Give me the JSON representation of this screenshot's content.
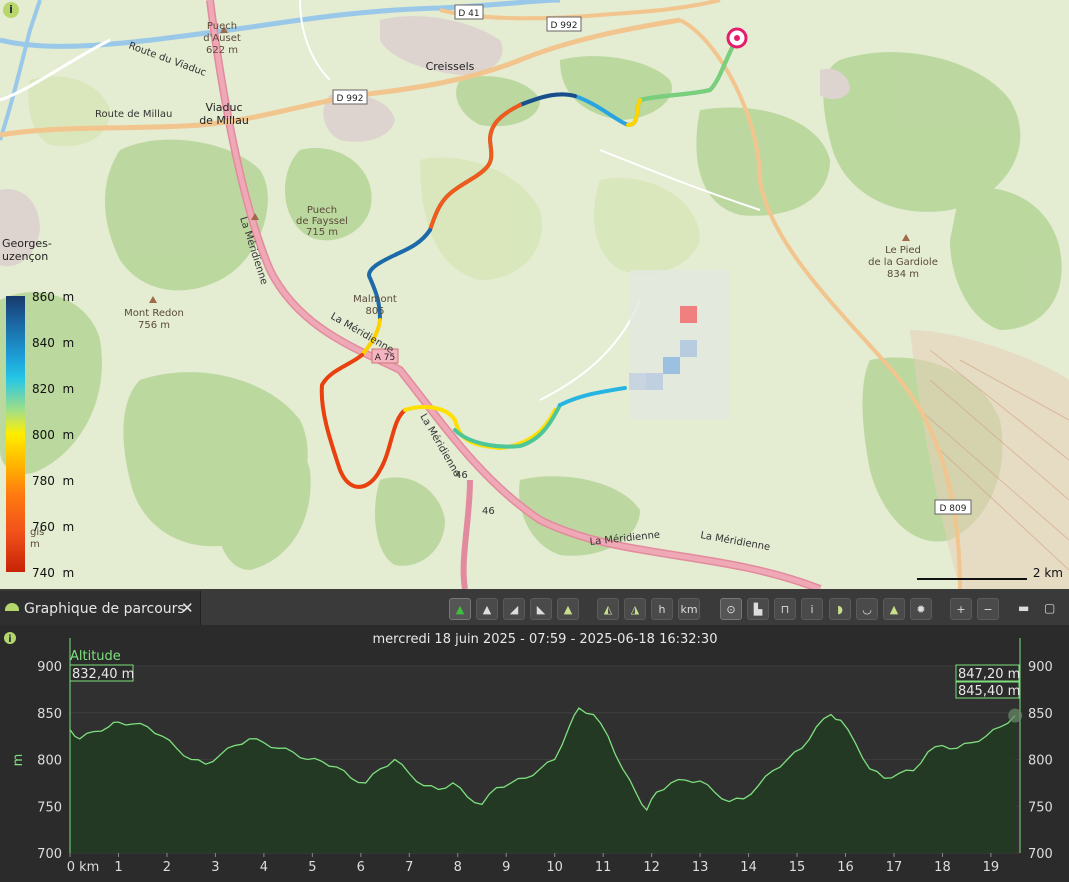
{
  "map": {
    "places": [
      {
        "name": "Puech\nd'Auset\n622 m"
      },
      {
        "name": "Creissels"
      },
      {
        "name": "Viaduc\nde Millau"
      },
      {
        "name": "Puech\nde Fayssel\n715 m"
      },
      {
        "name": "Mont Redon\n756 m"
      },
      {
        "name": "Malmont\n805"
      },
      {
        "name": "Le Pied\nde la Gardiole\n834 m"
      },
      {
        "name": "Georges-\nuzençon"
      },
      {
        "name": "gis\nm"
      }
    ],
    "roads": {
      "d41": "D 41",
      "d992a": "D 992",
      "d992b": "D 992",
      "a75": "A 75",
      "d809": "D 809",
      "route_viaduc": "Route du Viaduc",
      "route_millau": "Route de Millau",
      "meridienne": "La Méridienne",
      "a46": "46"
    },
    "scale_label": "2 km",
    "legend": {
      "ticks": [
        "860  m",
        "840  m",
        "820  m",
        "800  m",
        "780  m",
        "760  m",
        "740  m"
      ],
      "colors": [
        "#173a6b",
        "#1e9ed6",
        "#ffee00",
        "#ff7a10",
        "#c82208"
      ]
    },
    "info_icon": "info-icon"
  },
  "panel": {
    "title": "Graphique de parcours",
    "close_glyph": "✕",
    "toolbar_icons": [
      "altitude-icon",
      "slope-icon",
      "speed-icon",
      "pace-icon",
      "elevation-fill-icon",
      "vertical-icon",
      "hills-icon",
      "time-icon",
      "distance-km-icon",
      "center-icon",
      "chart-mode-icon",
      "compare-icon",
      "info-icon",
      "split-icon",
      "valley-icon",
      "peak-icon",
      "sun-icon",
      "zoom-in-icon",
      "zoom-out-icon"
    ],
    "km_label": "km",
    "h_label": "h",
    "plus": "+",
    "minus": "−"
  },
  "chart_data": {
    "type": "area",
    "title": "mercredi 18 juin 2025 - 07:59 - 2025-06-18  16:32:30",
    "series": [
      {
        "name": "Altitude",
        "color": "#7ee07e"
      }
    ],
    "ylabel": "m",
    "xlabel": "",
    "ylim": [
      700,
      900
    ],
    "xlim": [
      0,
      19.6
    ],
    "y_ticks": [
      "900",
      "850",
      "800",
      "750",
      "700"
    ],
    "x_ticks": [
      "0 km",
      "1",
      "2",
      "3",
      "4",
      "5",
      "6",
      "7",
      "8",
      "9",
      "10",
      "11",
      "12",
      "13",
      "14",
      "15",
      "16",
      "17",
      "18",
      "19"
    ],
    "start_value": "832,40 m",
    "end_values": [
      "847,20 m",
      "845,40 m"
    ],
    "x": [
      0,
      0.2,
      0.5,
      0.8,
      1,
      1.3,
      1.6,
      1.9,
      2.2,
      2.5,
      2.8,
      3.1,
      3.4,
      3.7,
      4,
      4.3,
      4.6,
      4.9,
      5.2,
      5.5,
      5.8,
      6.1,
      6.4,
      6.7,
      7,
      7.3,
      7.6,
      7.9,
      8.2,
      8.5,
      8.8,
      9.1,
      9.4,
      9.7,
      10,
      10.3,
      10.5,
      10.8,
      11.1,
      11.4,
      11.7,
      11.9,
      12.1,
      12.4,
      12.7,
      13,
      13.3,
      13.6,
      13.9,
      14.2,
      14.5,
      14.8,
      15.1,
      15.4,
      15.7,
      15.9,
      16.2,
      16.5,
      16.8,
      17.1,
      17.4,
      17.7,
      18,
      18.3,
      18.6,
      18.9,
      19.2,
      19.5
    ],
    "y": [
      832,
      822,
      830,
      835,
      840,
      838,
      835,
      825,
      812,
      800,
      795,
      805,
      815,
      822,
      818,
      812,
      808,
      800,
      798,
      792,
      780,
      775,
      790,
      800,
      785,
      772,
      768,
      775,
      760,
      752,
      770,
      775,
      780,
      790,
      800,
      835,
      855,
      848,
      825,
      790,
      762,
      746,
      765,
      775,
      778,
      777,
      765,
      755,
      758,
      772,
      788,
      800,
      812,
      835,
      848,
      842,
      818,
      790,
      780,
      785,
      788,
      808,
      815,
      812,
      818,
      825,
      835,
      847
    ]
  }
}
